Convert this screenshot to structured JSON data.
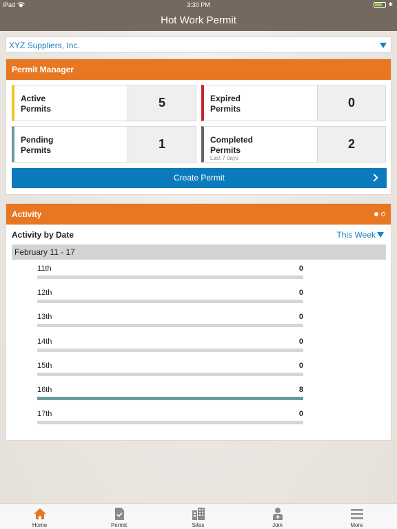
{
  "status_bar": {
    "device": "iPad",
    "time": "3:30 PM"
  },
  "header": {
    "title": "Hot Work Permit"
  },
  "company_select": {
    "value": "XYZ Suppliers, Inc."
  },
  "permit_manager": {
    "title": "Permit Manager",
    "tiles": [
      {
        "label_line1": "Active",
        "label_line2": "Permits",
        "count": "5",
        "color": "#f2c522",
        "sub": ""
      },
      {
        "label_line1": "Expired",
        "label_line2": "Permits",
        "count": "0",
        "color": "#c0272d",
        "sub": ""
      },
      {
        "label_line1": "Pending",
        "label_line2": "Permits",
        "count": "1",
        "color": "#6b9a9e",
        "sub": ""
      },
      {
        "label_line1": "Completed",
        "label_line2": "Permits",
        "count": "2",
        "color": "#666666",
        "sub": "Last 7 days"
      }
    ],
    "create_button": "Create Permit"
  },
  "activity": {
    "title": "Activity",
    "subtitle": "Activity by Date",
    "period_select": "This Week",
    "date_range": "February 11 - 17",
    "max": 8,
    "rows": [
      {
        "day": "11th",
        "count": 0
      },
      {
        "day": "12th",
        "count": 0
      },
      {
        "day": "13th",
        "count": 0
      },
      {
        "day": "14th",
        "count": 0
      },
      {
        "day": "15th",
        "count": 0
      },
      {
        "day": "16th",
        "count": 8
      },
      {
        "day": "17th",
        "count": 0
      }
    ]
  },
  "tabbar": {
    "items": [
      {
        "label": "Home",
        "icon": "home-icon"
      },
      {
        "label": "Permit",
        "icon": "permit-document-icon"
      },
      {
        "label": "Sites",
        "icon": "building-icon"
      },
      {
        "label": "Join",
        "icon": "person-add-icon"
      },
      {
        "label": "More",
        "icon": "menu-icon"
      }
    ],
    "accent": "#e87722"
  }
}
